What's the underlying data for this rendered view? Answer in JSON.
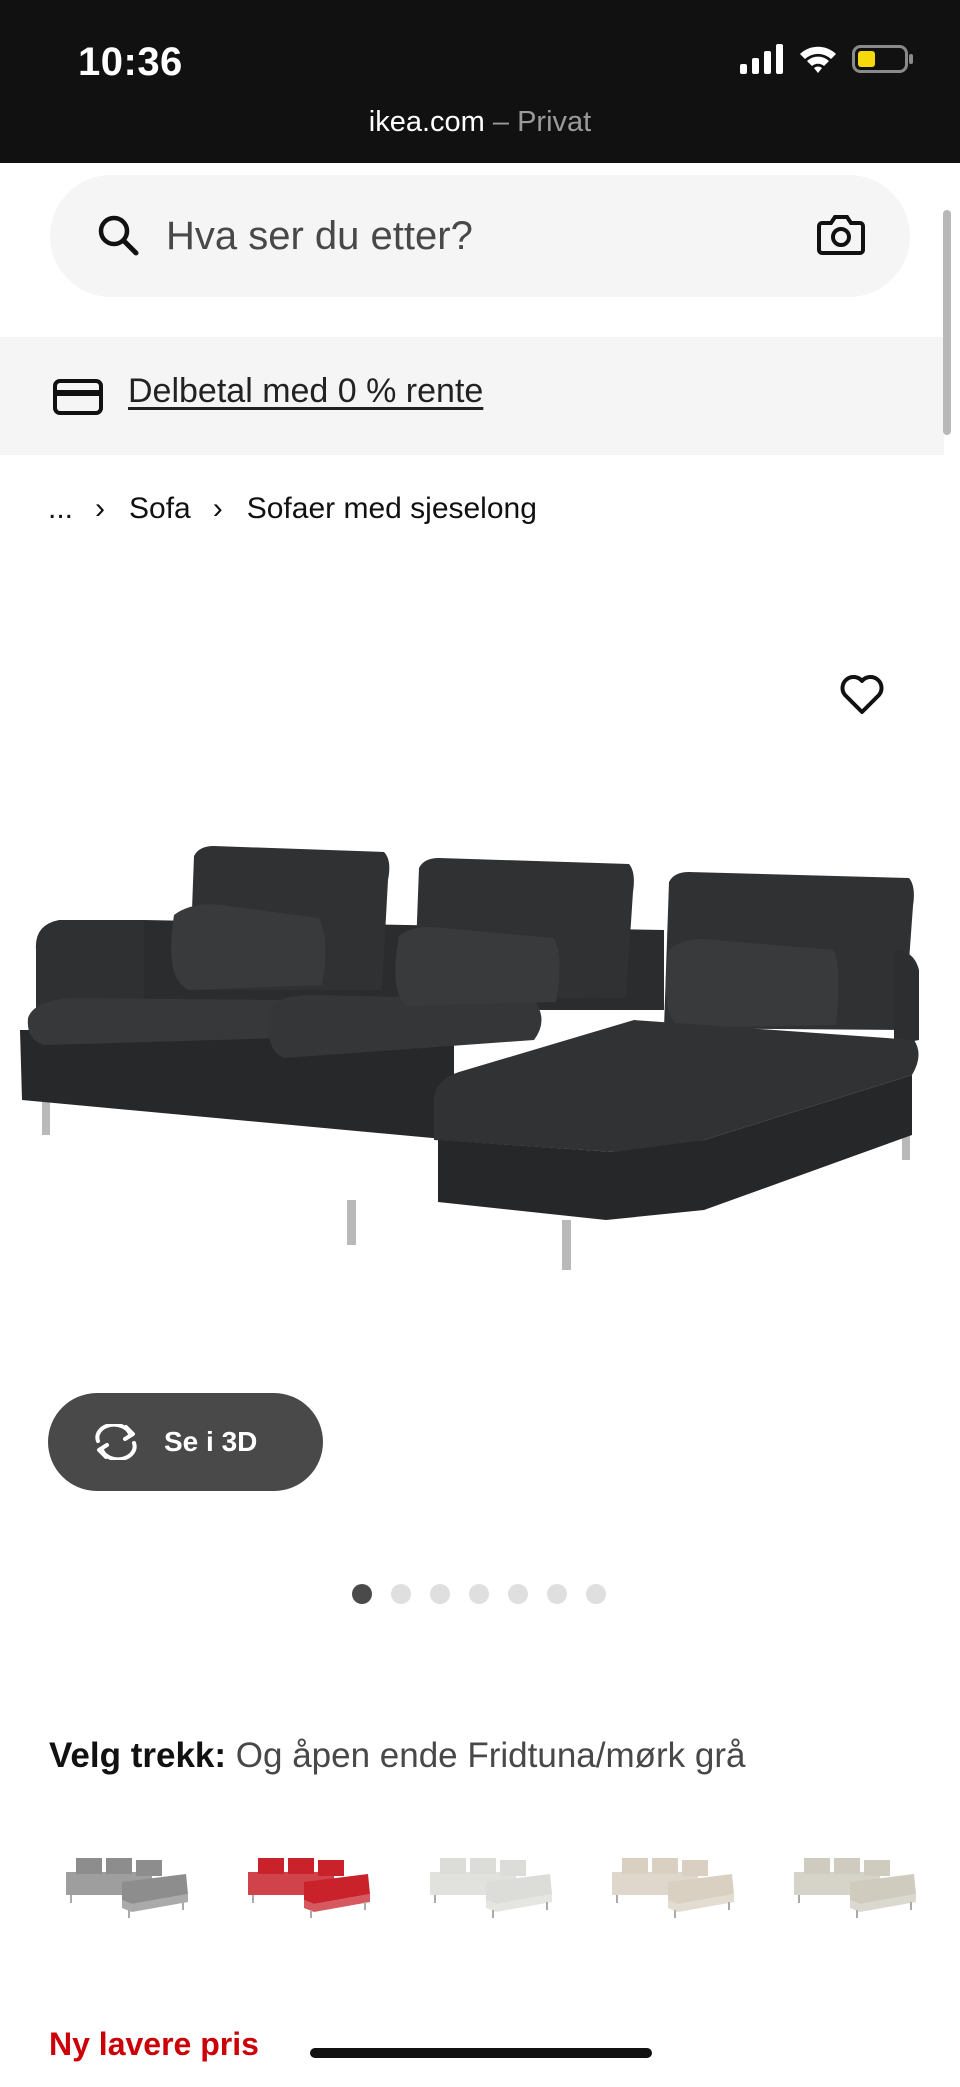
{
  "status_bar": {
    "time": "10:36",
    "url_host": "ikea.com",
    "url_suffix": " – Privat",
    "icons": [
      "cellular-signal-icon",
      "wifi-icon",
      "battery-icon"
    ]
  },
  "search": {
    "placeholder": "Hva ser du etter?",
    "value": "",
    "icons": [
      "search-icon",
      "camera-icon"
    ]
  },
  "promo": {
    "label": "Delbetal med 0 % rente",
    "icon": "credit-card-icon"
  },
  "breadcrumb": {
    "ellipsis": "...",
    "items": [
      "Sofa",
      "Sofaer med sjeselong"
    ],
    "separator": "›"
  },
  "product": {
    "favorite_icon": "heart-outline-icon",
    "image_alt": "sofa-with-chaise-dark-grey",
    "view_3d_label": "Se i 3D",
    "view_3d_icon": "rotate-3d-icon",
    "gallery": {
      "total": 7,
      "active_index": 0
    }
  },
  "cover": {
    "prefix": "Velg trekk:",
    "value": "Og åpen ende Fridtuna/mørk grå",
    "swatches": [
      {
        "name": "grey",
        "color": "#8d8d8d"
      },
      {
        "name": "red",
        "color": "#c9222b"
      },
      {
        "name": "light-grey-white",
        "color": "#dcdcd8"
      },
      {
        "name": "beige",
        "color": "#d9d0c2"
      },
      {
        "name": "light-beige-grey",
        "color": "#cfcbbf"
      }
    ]
  },
  "price_badge": {
    "label": "Ny lavere pris",
    "color": "#cc0008"
  }
}
